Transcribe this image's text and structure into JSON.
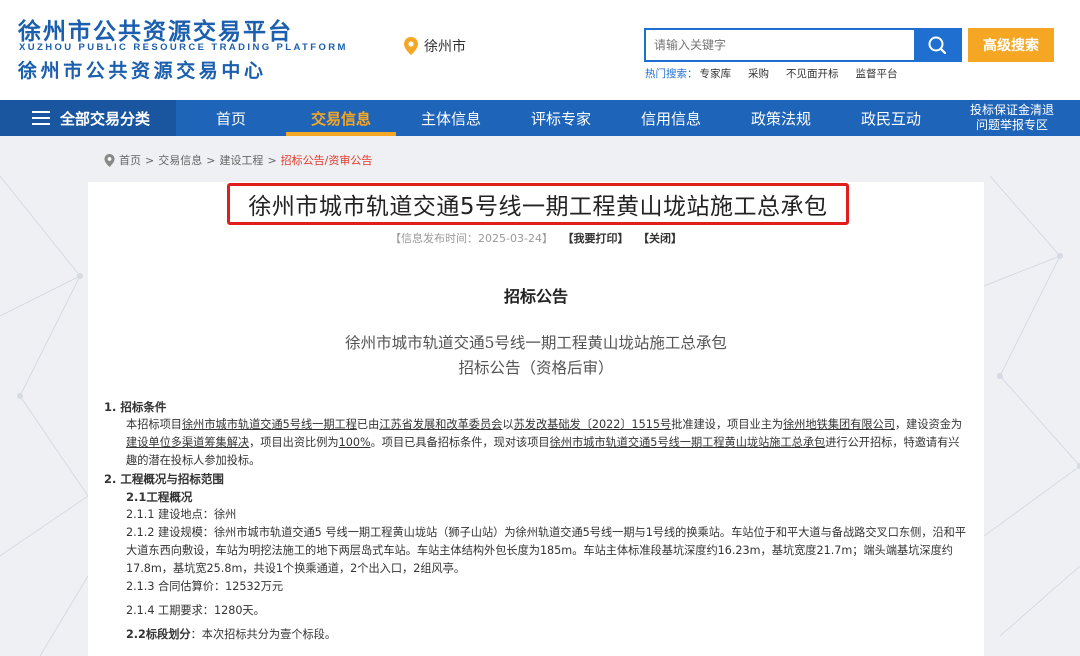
{
  "header": {
    "logo_cn_top": "徐州市公共资源交易平台",
    "logo_en": "XUZHOU PUBLIC RESOURCE TRADING PLATFORM",
    "logo_cn_bottom": "徐州市公共资源交易中心",
    "city": "徐州市",
    "search_placeholder": "请输入关键字",
    "advanced_search": "高级搜索",
    "hot_label": "热门搜索：",
    "hot_items": [
      "专家库",
      "采购",
      "不见面开标",
      "监督平台"
    ]
  },
  "nav": {
    "all_label": "全部交易分类",
    "items": [
      "首页",
      "交易信息",
      "主体信息",
      "评标专家",
      "信用信息",
      "政策法规",
      "政民互动"
    ],
    "special_line1": "投标保证金清退",
    "special_line2": "问题举报专区"
  },
  "breadcrumb": [
    "首页",
    "交易信息",
    "建设工程",
    "招标公告/资审公告"
  ],
  "article": {
    "title": "徐州市城市轨道交通5号线一期工程黄山垅站施工总承包",
    "publish": "【信息发布时间：2025-03-24】",
    "print": "【我要打印】",
    "close": "【关闭】",
    "notice_head": "招标公告",
    "sub_title1": "徐州市城市轨道交通5号线一期工程黄山垅站施工总承包",
    "sub_title2": "招标公告（资格后审）",
    "s1_head": "1.  招标条件",
    "s1_a": "本招标项目",
    "s1_b": "徐州市城市轨道交通5号线一期工程",
    "s1_c": "已由",
    "s1_d": "江苏省发展和改革委员会",
    "s1_e": "以",
    "s1_f": "苏发改基础发〔2022〕1515号",
    "s1_g": "批准建设，项目业主为",
    "s1_h": "徐州地铁集团有限公司",
    "s1_i": "，建设资金为",
    "s1_j": "建设单位多渠道筹集解决",
    "s1_k": "，项目出资比例为",
    "s1_l": "100%",
    "s1_m": "。项目已具备招标条件，现对该项目",
    "s1_n": "徐州市城市轨道交通5号线一期工程黄山垅站施工总承包",
    "s1_o": "进行公开招标，特邀请有兴趣的潜在投标人参加投标。",
    "s2_head": "2.  工程概况与招标范围",
    "s21_head": "2.1工程概况",
    "s211": "2.1.1 建设地点：徐州",
    "s212": "2.1.2 建设规模：徐州市城市轨道交通5 号线一期工程黄山垅站（狮子山站）为徐州轨道交通5号线一期与1号线的换乘站。车站位于和平大道与备战路交叉口东侧，沿和平大道东西向敷设，车站为明挖法施工的地下两层岛式车站。车站主体结构外包长度为185m。车站主体标准段基坑深度约16.23m，基坑宽度21.7m；端头端基坑深度约17.8m，基坑宽25.8m，共设1个换乘通道，2个出入口，2组风亭。",
    "s213": "2.1.3 合同估算价：12532万元",
    "s214": "2.1.4 工期要求：1280天。",
    "s22_head": "2.2标段划分",
    "s22_text": "：本次招标共分为壹个标段。"
  }
}
